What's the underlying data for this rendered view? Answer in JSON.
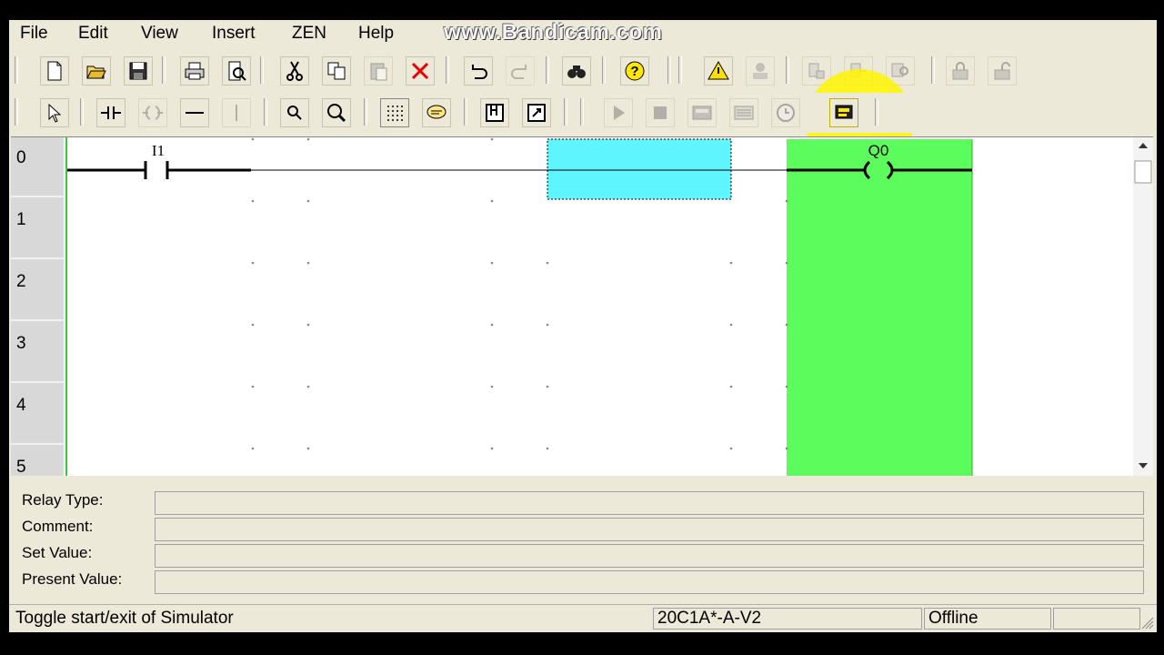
{
  "watermark": "www.Bandicam.com",
  "menu": {
    "file": "File",
    "edit": "Edit",
    "view": "View",
    "insert": "Insert",
    "zen": "ZEN",
    "help": "Help"
  },
  "toolbar1": [
    "new-icon",
    "open-icon",
    "save-icon",
    "print-icon",
    "print-preview-icon",
    "cut-icon",
    "copy-icon",
    "paste-icon",
    "delete-icon",
    "undo-icon",
    "redo-icon",
    "find-icon",
    "help-icon",
    "warning-icon",
    "transfer-icon",
    "program-transfer-icon",
    "compare-icon",
    "monitor-icon",
    "lock-icon",
    "unlock-icon"
  ],
  "toolbar2": [
    "select-icon",
    "contact-icon",
    "coil-icon",
    "horizontal-line-icon",
    "vertical-line-icon",
    "zoom-out-icon",
    "zoom-in-icon",
    "grid-icon",
    "comment-icon",
    "bit-io-icon",
    "function-block-icon",
    "run-icon",
    "stop-icon",
    "io-monitor-icon",
    "list-icon",
    "clock-icon",
    "simulator-icon"
  ],
  "ladder": {
    "rows": [
      "0",
      "1",
      "2",
      "3",
      "4",
      "5"
    ],
    "contact_label": "I1",
    "coil_label": "Q0"
  },
  "info": {
    "relay_type": "Relay Type:",
    "comment": "Comment:",
    "set_value": "Set Value:",
    "present_value": "Present Value:"
  },
  "status": {
    "message": "Toggle start/exit of Simulator",
    "model": "20C1A*-A-V2",
    "connection": "Offline"
  },
  "colors": {
    "output_column": "#5dfc5d",
    "selection_cell": "#5ff5ff",
    "highlight": "#fff500"
  }
}
